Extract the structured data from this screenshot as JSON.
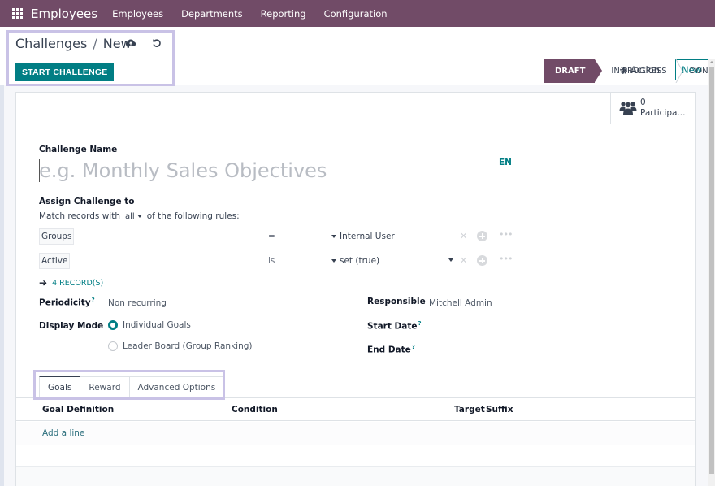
{
  "navbar": {
    "app_name": "Employees",
    "menu": [
      "Employees",
      "Departments",
      "Reporting",
      "Configuration"
    ]
  },
  "control": {
    "breadcrumb_parent": "Challenges",
    "breadcrumb_separator": "/",
    "breadcrumb_current": "New",
    "start_button": "START CHALLENGE",
    "action_label": "Action",
    "new_label": "New"
  },
  "status": {
    "stages": [
      "DRAFT",
      "IN PROGRESS",
      "DONE"
    ],
    "active": "DRAFT"
  },
  "smart_button": {
    "count": "0",
    "label": "Participa..."
  },
  "form": {
    "challenge_name_label": "Challenge Name",
    "challenge_name_placeholder": "e.g. Monthly Sales Objectives",
    "challenge_name_value": "",
    "lang": "EN",
    "assign_label": "Assign Challenge to",
    "match_prefix": "Match records with",
    "match_value": "all",
    "match_suffix": "of the following rules:",
    "rules": [
      {
        "path": "Groups",
        "operator": "=",
        "value": "Internal User"
      },
      {
        "path": "Active",
        "operator": "is",
        "value": "set (true)"
      }
    ],
    "records_link": "4 RECORD(S)",
    "periodicity_label": "Periodicity",
    "periodicity_value": "Non recurring",
    "display_mode_label": "Display Mode",
    "display_mode_options": [
      "Individual Goals",
      "Leader Board (Group Ranking)"
    ],
    "display_mode_selected": "Individual Goals",
    "responsible_label": "Responsible",
    "responsible_value": "Mitchell Admin",
    "start_date_label": "Start Date",
    "end_date_label": "End Date",
    "help_mark": "?"
  },
  "tabs": {
    "items": [
      "Goals",
      "Reward",
      "Advanced Options"
    ],
    "active": "Goals"
  },
  "goals_list": {
    "columns": [
      "Goal Definition",
      "Condition",
      "Target",
      "Suffix"
    ],
    "add_line": "Add a line"
  },
  "colors": {
    "brand": "#714b67",
    "primary": "#017e84",
    "highlight": "#c9c2e6"
  }
}
